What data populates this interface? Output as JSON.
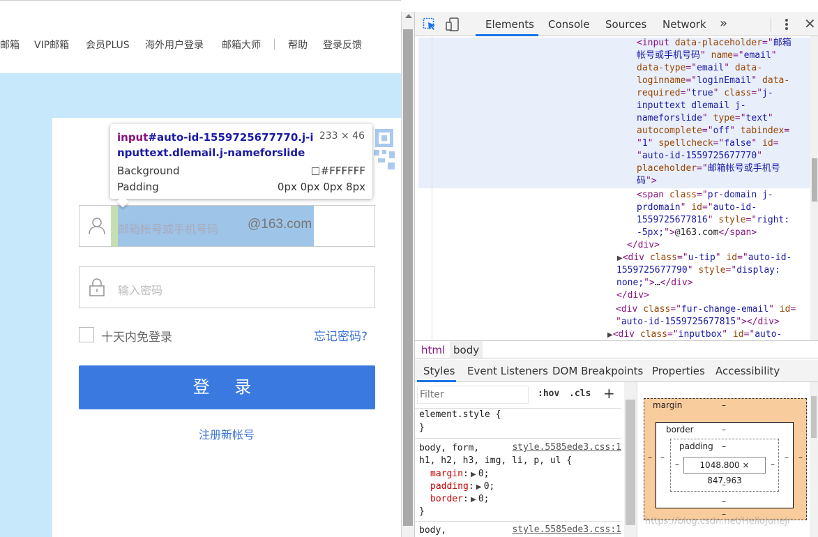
{
  "topnav": {
    "items": [
      "邮箱",
      "VIP邮箱",
      "会员PLUS",
      "海外用户登录",
      "邮箱大师",
      "帮助",
      "登录反馈"
    ]
  },
  "login": {
    "user_placeholder": "邮箱帐号或手机号码",
    "domain_suffix": "@163.com",
    "password_placeholder": "输入密码",
    "remember_label": "十天内免登录",
    "forgot_link": "忘记密码?",
    "login_button": "登 录",
    "register_link": "注册新帐号"
  },
  "tooltip": {
    "selector_tag": "input",
    "selector_rest": "#auto-id-1559725677770.j-inputtext.dlemail.j-nameforslide",
    "dimensions": "233 × 46",
    "background_label": "Background",
    "background_value": "#FFFFFF",
    "padding_label": "Padding",
    "padding_value": "0px 0px 0px 8px"
  },
  "devtools": {
    "tabs": [
      "Elements",
      "Console",
      "Sources",
      "Network"
    ],
    "more_tabs": "»",
    "breadcrumbs": [
      "html",
      "body"
    ],
    "subtabs": [
      "Styles",
      "Event Listeners",
      "DOM Breakpoints",
      "Properties",
      "Accessibility"
    ],
    "filter_placeholder": "Filter",
    "hov": ":hov",
    "cls": ".cls",
    "plus": "+",
    "element_style": "element.style {",
    "close_brace": "}",
    "rule1_selector_line1": "body, form,",
    "rule1_selector_line2": "h1, h2, h3, img, li, p, ul {",
    "rule1_source": "style.5585ede3.css:1",
    "rule1_props": [
      {
        "name": "margin",
        "value": "0;"
      },
      {
        "name": "padding",
        "value": "0;"
      },
      {
        "name": "border",
        "value": "0;"
      }
    ],
    "rule2_selector": "body,",
    "rule2_source": "style.5585ede3.css:1",
    "box_model": {
      "margin_label": "margin",
      "border_label": "border",
      "padding_label": "padding",
      "dash": "–",
      "content": "1048.800 × 847.963"
    }
  },
  "watermark": "https://blog.csdn.net/HelloJuneJr"
}
